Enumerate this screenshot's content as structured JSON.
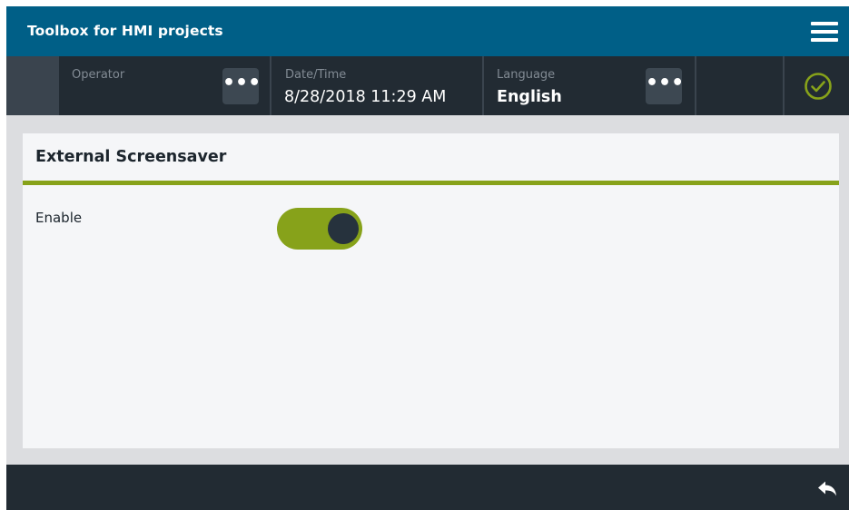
{
  "titlebar": {
    "title": "Toolbox for HMI projects",
    "menu_icon": "hamburger-menu-icon"
  },
  "statusbar": {
    "operator": {
      "label": "Operator",
      "value": "",
      "more_label": "•••"
    },
    "datetime": {
      "label": "Date/Time",
      "value": "8/28/2018 11:29 AM"
    },
    "language": {
      "label": "Language",
      "value": "English",
      "more_label": "•••"
    },
    "status_icon": "checkmark-circle-icon"
  },
  "panel": {
    "title": "External Screensaver",
    "enable_label": "Enable",
    "enable_state": true
  },
  "bottombar": {
    "back_icon": "reply-arrow-icon"
  },
  "colors": {
    "titlebar_bg": "#005f87",
    "statusbar_bg": "#222b33",
    "accent_green": "#87a21a",
    "panel_bg": "#f5f6f8",
    "frame_bg": "#dcdde0"
  }
}
